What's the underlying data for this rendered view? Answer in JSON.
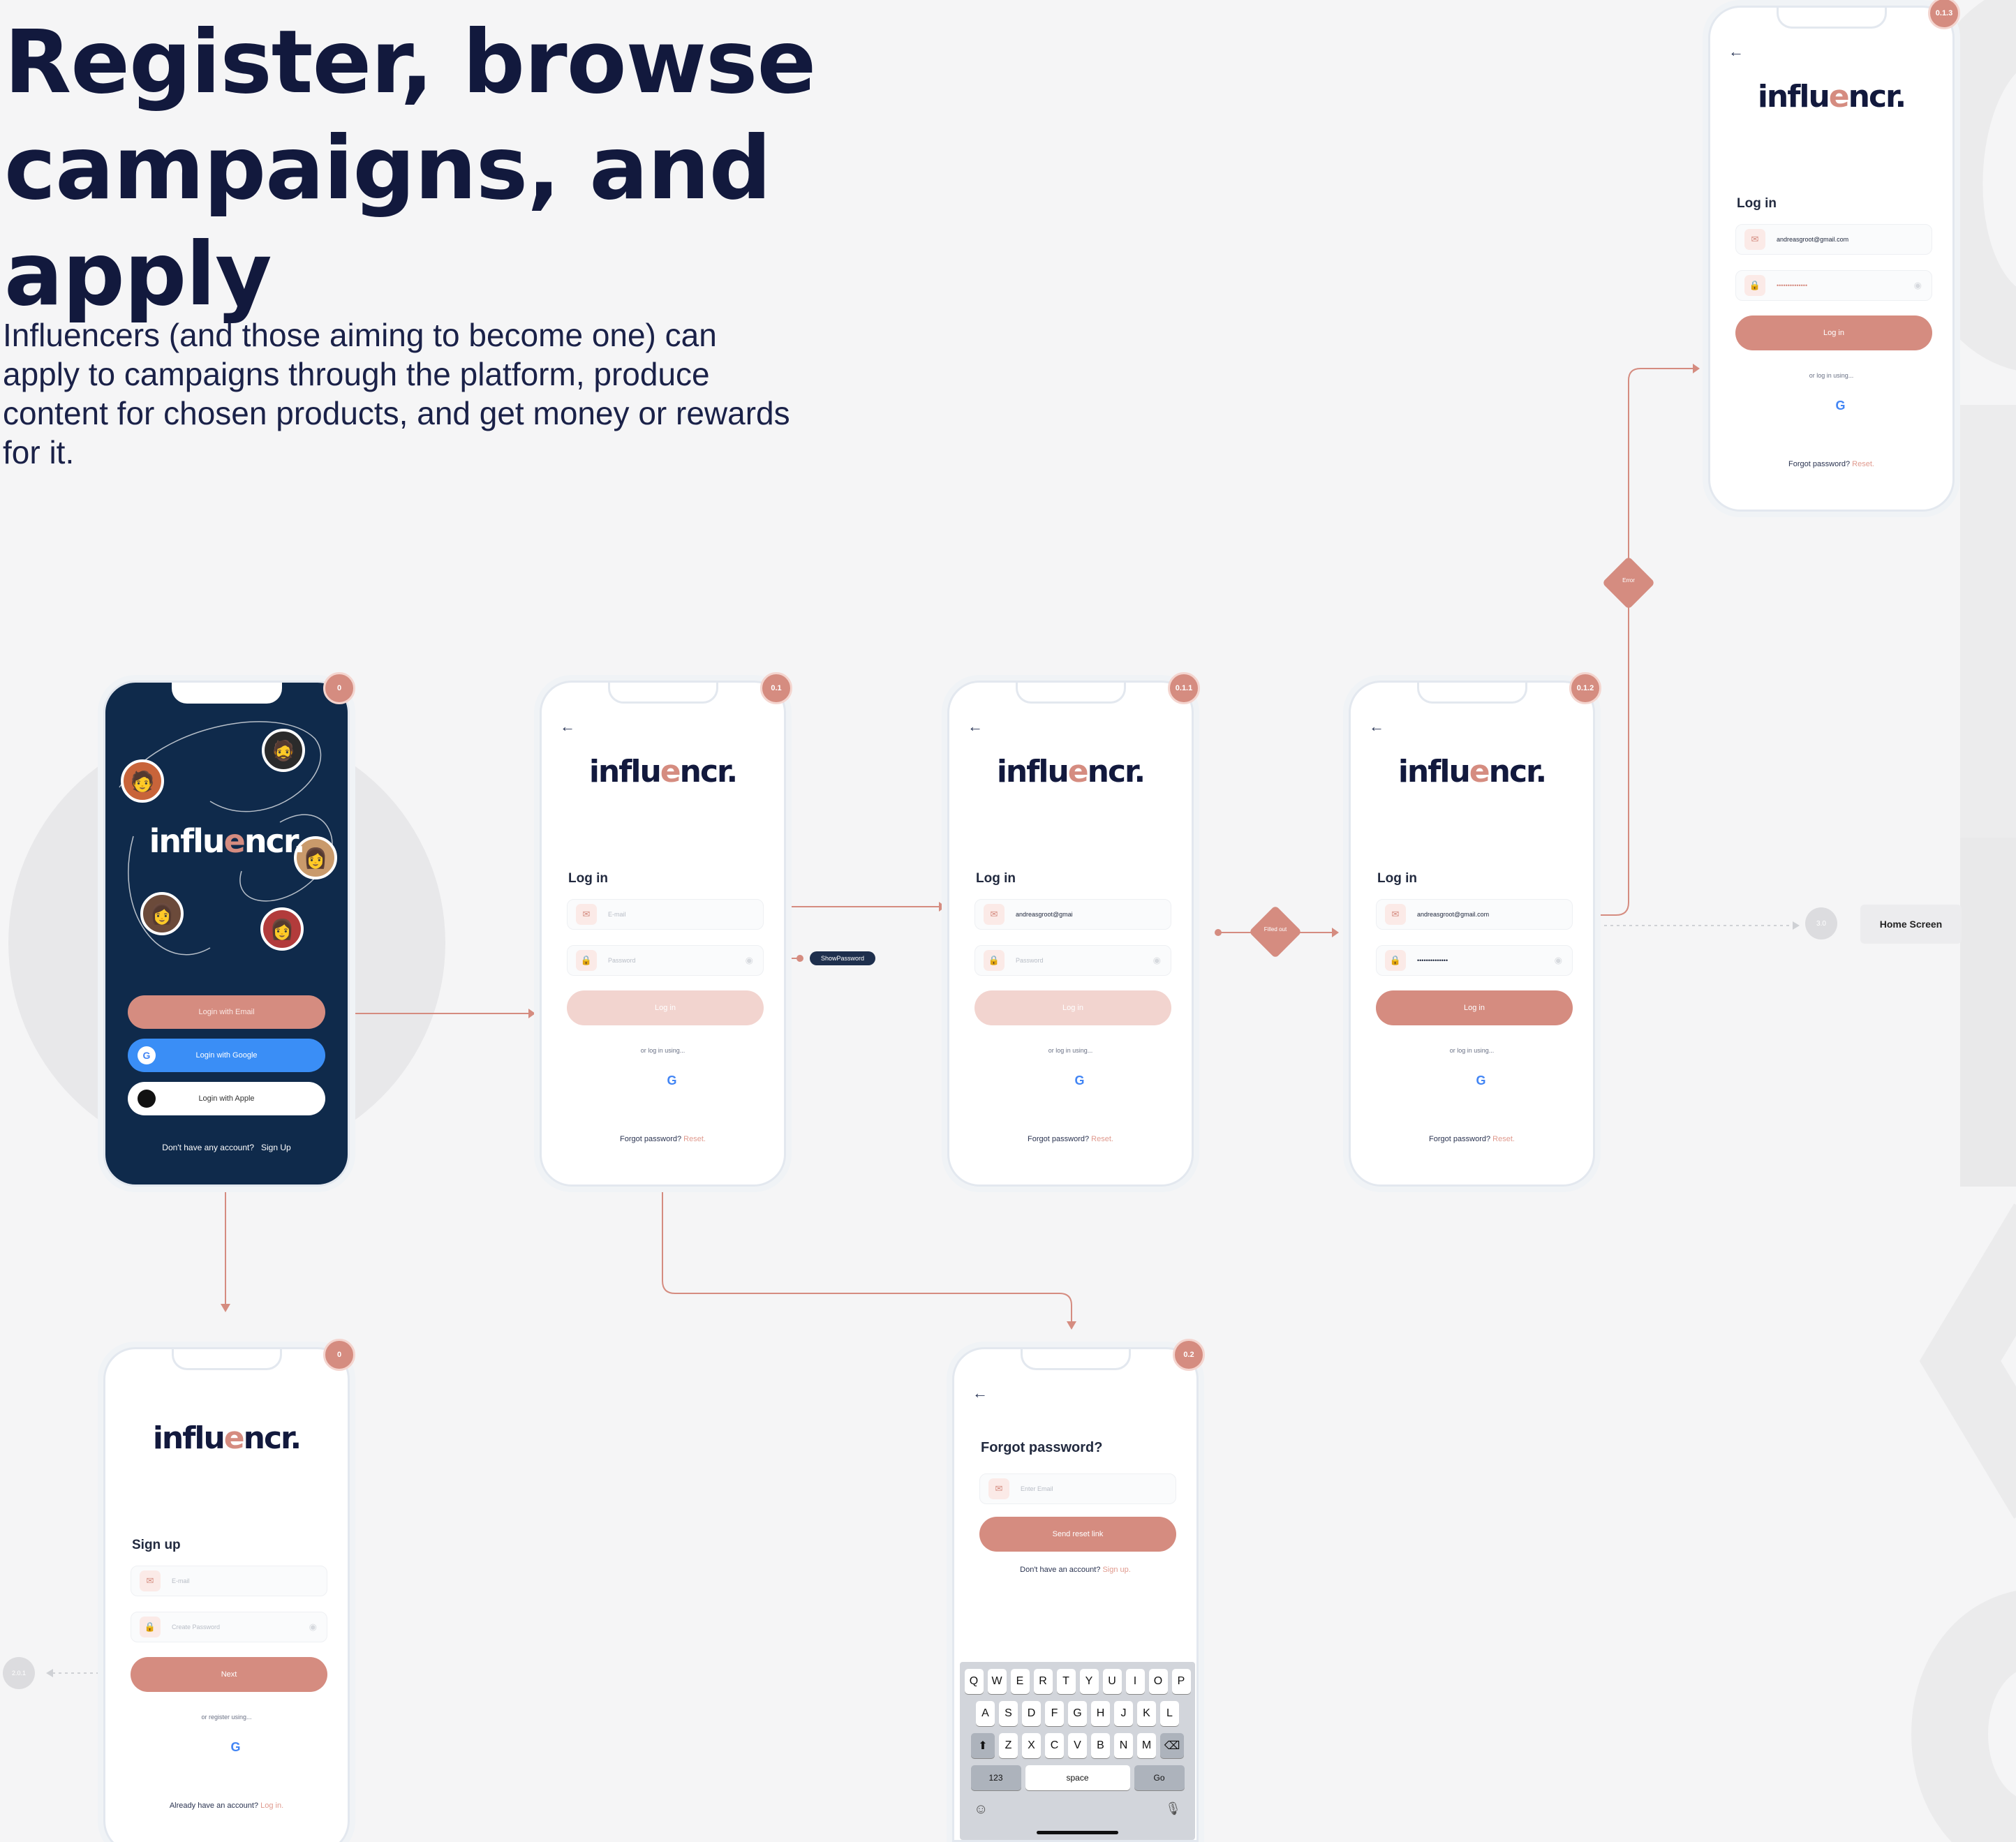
{
  "header": {
    "title_line1": "Register, browse",
    "title_line2": "campaigns, and apply",
    "description": "Influencers (and those aiming to become one) can apply to campaigns through the platform, produce content for chosen products, and get money or rewards for it."
  },
  "brand": {
    "logo_a": "influ",
    "logo_b": "e",
    "logo_c": "ncr."
  },
  "labels": {
    "show_password": "ShowPassword",
    "filled_out": "Filled out",
    "error": "Error",
    "home_screen": "Home Screen",
    "node_30": "3.0",
    "node_201": "2.0.1"
  },
  "welcome": {
    "badge": "0",
    "email_btn": "Login with Email",
    "google_btn": "Login with Google",
    "apple_btn": "Login with Apple",
    "no_account": "Don't have any account?",
    "sign_up": "Sign Up"
  },
  "login": {
    "heading": "Log in",
    "email_placeholder": "E-mail",
    "password_placeholder": "Password",
    "button": "Log in",
    "or": "or log in using...",
    "forgot": "Forgot password?",
    "reset": "Reset.",
    "email_partial": "andreasgroot@gmai",
    "email_full": "andreasgroot@gmail.com",
    "password_mask": "••••••••••••••",
    "badges": [
      "0.1",
      "0.1.1",
      "0.1.2",
      "0.1.3"
    ]
  },
  "signup": {
    "badge": "0",
    "heading": "Sign up",
    "email_placeholder": "E-mail",
    "password_placeholder": "Create Password",
    "button": "Next",
    "or": "or register using...",
    "already": "Already have an account?",
    "login_link": "Log in."
  },
  "forgot": {
    "badge": "0.2",
    "heading": "Forgot password?",
    "email_placeholder": "Enter Email",
    "button": "Send reset link",
    "no_account": "Don't have an account?",
    "sign_up": "Sign up."
  },
  "keyboard": {
    "row1": [
      "Q",
      "W",
      "E",
      "R",
      "T",
      "Y",
      "U",
      "I",
      "O",
      "P"
    ],
    "row2": [
      "A",
      "S",
      "D",
      "F",
      "G",
      "H",
      "J",
      "K",
      "L"
    ],
    "row3": [
      "Z",
      "X",
      "C",
      "V",
      "B",
      "N",
      "M"
    ],
    "num": "123",
    "space": "space",
    "go": "Go"
  },
  "icons": {
    "back": "←",
    "mail": "✉",
    "lock": "🔒",
    "eye": "◉",
    "apple": "",
    "google": "G"
  },
  "colors": {
    "accent": "#d58c80",
    "navy": "#12193d",
    "dark_bg": "#0f2a4b",
    "google_btn": "#3a8ef6"
  }
}
